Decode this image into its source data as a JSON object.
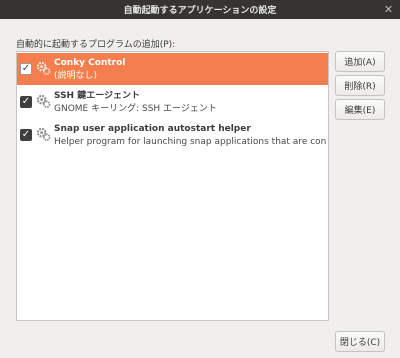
{
  "window": {
    "title": "自動起動するアプリケーションの設定",
    "close_glyph": "✕"
  },
  "section_label": "自動的に起動するプログラムの追加(P):",
  "programs": [
    {
      "name": "Conky Control",
      "description": "(説明なし)",
      "checked": true,
      "selected": true,
      "icon": "gears-icon"
    },
    {
      "name": "SSH 鍵エージェント",
      "description": "GNOME キーリング: SSH エージェント",
      "checked": true,
      "selected": false,
      "icon": "gears-icon"
    },
    {
      "name": "Snap user application autostart helper",
      "description": "Helper program for launching snap applications that are configured ···",
      "checked": true,
      "selected": false,
      "icon": "gears-icon"
    }
  ],
  "buttons": {
    "add": "追加(A)",
    "remove": "削除(R)",
    "edit": "編集(E)",
    "close": "閉じる(C)"
  },
  "colors": {
    "selection": "#f47e4d",
    "titlebar": "#363431"
  },
  "checkmark_glyph": "✓"
}
